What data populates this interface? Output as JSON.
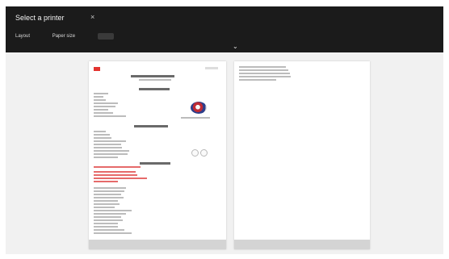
{
  "header": {
    "title": "Select a printer",
    "close_symbol": "×",
    "tabs": [
      {
        "label": "Layout"
      },
      {
        "label": "Paper size"
      }
    ],
    "collapse_symbol": "⌄"
  },
  "preview": {
    "pages": [
      {
        "footer": ""
      },
      {
        "footer": ""
      }
    ]
  },
  "icons": {
    "close": "close-icon",
    "collapse": "chevron-down-icon",
    "logo": "logo-icon",
    "product": "product-image"
  },
  "colors": {
    "toolbar": "#1b1b1b",
    "workspace": "#f1f1f1",
    "page": "#ffffff",
    "accent": "#e3342f"
  }
}
